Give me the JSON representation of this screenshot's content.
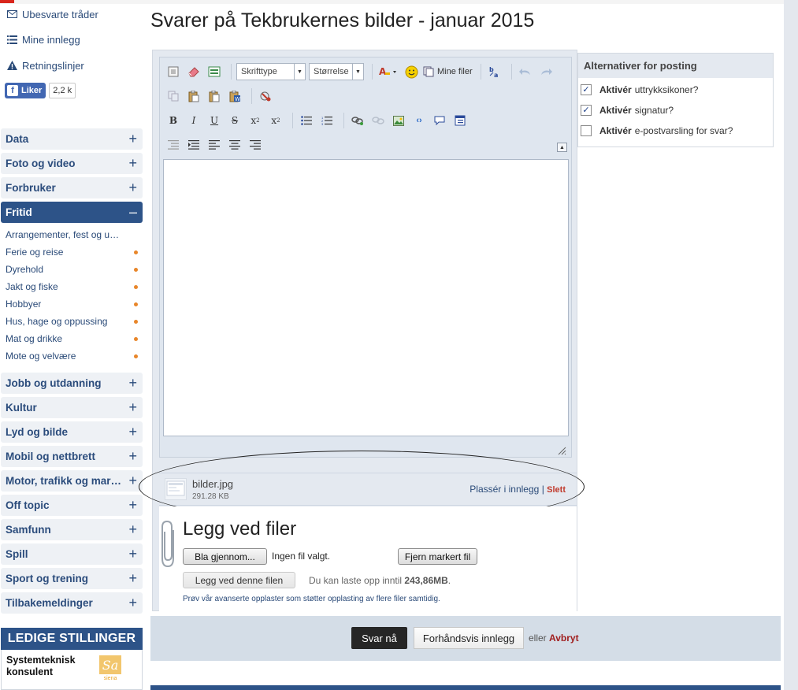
{
  "page": {
    "title": "Svarer på Tekbrukernes bilder - januar 2015"
  },
  "sidebar": {
    "links": [
      {
        "label": "Ubesvarte tråder",
        "icon": "envelope-icon"
      },
      {
        "label": "Mine innlegg",
        "icon": "list-icon"
      },
      {
        "label": "Retningslinjer",
        "icon": "warning-icon"
      }
    ],
    "facebook": {
      "label": "Liker",
      "count": "2,2 k"
    },
    "categories_top": [
      {
        "label": "Data",
        "sign": "+"
      },
      {
        "label": "Foto og video",
        "sign": "+"
      },
      {
        "label": "Forbruker",
        "sign": "+"
      }
    ],
    "active_category": {
      "label": "Fritid",
      "sign": "–"
    },
    "subitems": [
      {
        "label": "Arrangementer, fest og u…",
        "dot": false
      },
      {
        "label": "Ferie og reise",
        "dot": true
      },
      {
        "label": "Dyrehold",
        "dot": true
      },
      {
        "label": "Jakt og fiske",
        "dot": true
      },
      {
        "label": "Hobbyer",
        "dot": true
      },
      {
        "label": "Hus, hage og oppussing",
        "dot": true
      },
      {
        "label": "Mat og drikke",
        "dot": true
      },
      {
        "label": "Mote og velvære",
        "dot": true
      }
    ],
    "categories_bottom": [
      {
        "label": "Jobb og utdanning",
        "sign": "+"
      },
      {
        "label": "Kultur",
        "sign": "+"
      },
      {
        "label": "Lyd og bilde",
        "sign": "+"
      },
      {
        "label": "Mobil og nettbrett",
        "sign": "+"
      },
      {
        "label": "Motor, trafikk og mar…",
        "sign": "+"
      },
      {
        "label": "Off topic",
        "sign": "+"
      },
      {
        "label": "Samfunn",
        "sign": "+"
      },
      {
        "label": "Spill",
        "sign": "+"
      },
      {
        "label": "Sport og trening",
        "sign": "+"
      },
      {
        "label": "Tilbakemeldinger",
        "sign": "+"
      }
    ],
    "jobs": {
      "heading": "LEDIGE STILLINGER",
      "job_title": "Systemteknisk konsulent",
      "logo_text": "siena"
    }
  },
  "editor": {
    "font_select": "Skrifttype",
    "size_select": "Størrelse",
    "my_files": "Mine filer"
  },
  "attachment": {
    "filename": "bilder.jpg",
    "size": "291.28 KB",
    "place_label": "Plassér i innlegg",
    "separator": "|",
    "delete_label": "Slett"
  },
  "upload": {
    "title": "Legg ved filer",
    "browse": "Bla gjennom...",
    "no_file": "Ingen fil valgt.",
    "remove": "Fjern markert fil",
    "attach": "Legg ved denne filen",
    "quota_text": "Du kan laste opp inntil",
    "quota_value": "243,86MB",
    "quota_end": ".",
    "advanced": "Prøv vår avanserte opplaster som støtter opplasting av flere filer samtidig."
  },
  "options": {
    "heading": "Alternativer for posting",
    "items": [
      {
        "bold": "Aktivér",
        "text": "uttrykksikoner?",
        "checked": true,
        "mark": "✓"
      },
      {
        "bold": "Aktivér",
        "text": "signatur?",
        "checked": true,
        "mark": "✓"
      },
      {
        "bold": "Aktivér",
        "text": "e-postvarsling for svar?",
        "checked": false,
        "mark": ""
      }
    ]
  },
  "actions": {
    "submit": "Svar nå",
    "preview": "Forhåndsvis innlegg",
    "or": "eller",
    "cancel": "Avbryt"
  },
  "colors": {
    "brand_blue": "#2d5388",
    "link_blue": "#2a4a78",
    "dot_orange": "#e8862a",
    "delete_red": "#c0392b",
    "submit_dark": "#262626"
  }
}
